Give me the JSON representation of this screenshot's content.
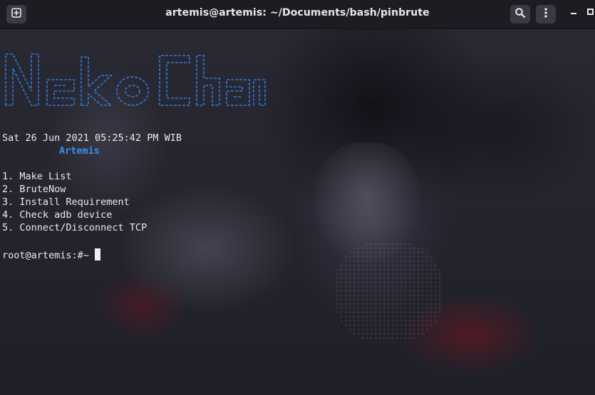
{
  "window": {
    "title": "artemis@artemis: ~/Documents/bash/pinbrute",
    "icons": {
      "new_tab": "new-tab-icon",
      "search": "search-icon",
      "menu": "kebab-menu-icon",
      "minimize": "minimize-icon",
      "maximize": "maximize-icon"
    }
  },
  "terminal": {
    "banner_lines": [
      " _  _        _          ___  _",
      "| \\| | ___  | | __ ___ / __|| |_   __ _  _ _",
      "| .` |/ -_) | |/ // _ \\ (__ | ' \\ / _` || ' \\",
      "|_|\\_|\\___| |_|\\_\\\\___/\\___||_||_|\\__,_||_||_|"
    ],
    "banner_text": "NekoChan",
    "datetime": "Sat 26 Jun 2021 05:25:42 PM WIB",
    "username": "Artemis",
    "menu_items": [
      "1. Make List",
      "2. BruteNow",
      "3. Install Requirement",
      "4. Check adb device",
      "5. Connect/Disconnect TCP"
    ],
    "prompt": "root@artemis:#~"
  },
  "colors": {
    "banner": "#2f79d8",
    "username": "#3b8ef0",
    "text": "#e9e9e9",
    "titlebar": "#1c1c22"
  }
}
